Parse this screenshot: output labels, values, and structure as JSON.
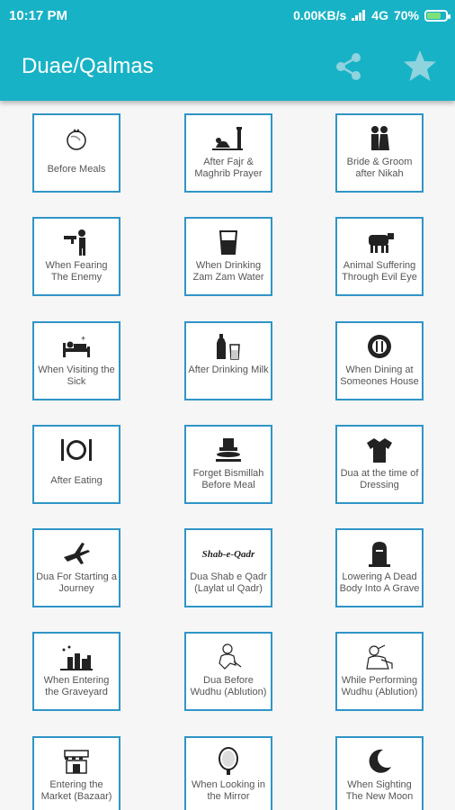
{
  "status_bar": {
    "time": "10:17 PM",
    "network": "0.00KB/s",
    "network_type": "4G",
    "battery": "70%"
  },
  "app_bar": {
    "title": "Duae/Qalmas",
    "share_icon": "share-icon",
    "favorite_icon": "star-icon"
  },
  "items": [
    {
      "label": "Before Meals",
      "icon": "pomegranate-icon"
    },
    {
      "label": "After Fajr & Maghrib Prayer",
      "icon": "prayer-icon"
    },
    {
      "label": "Bride & Groom after Nikah",
      "icon": "couple-icon"
    },
    {
      "label": "When Fearing The Enemy",
      "icon": "gunman-icon"
    },
    {
      "label": "When Drinking Zam Zam Water",
      "icon": "water-glass-icon"
    },
    {
      "label": "Animal Suffering Through Evil Eye",
      "icon": "cow-icon"
    },
    {
      "label": "When Visiting the Sick",
      "icon": "hospital-bed-icon"
    },
    {
      "label": "After Drinking Milk",
      "icon": "milk-icon"
    },
    {
      "label": "When Dining at Someones House",
      "icon": "dining-plate-icon"
    },
    {
      "label": "After Eating",
      "icon": "plate-cutlery-icon"
    },
    {
      "label": "Forget Bismillah Before Meal",
      "icon": "food-stack-icon"
    },
    {
      "label": "Dua at the time of Dressing",
      "icon": "shirt-icon"
    },
    {
      "label": "Dua For Starting a Journey",
      "icon": "airplane-icon"
    },
    {
      "label": "Dua Shab e Qadr (Laylat ul Qadr)",
      "icon": "shab-e-qadr-icon",
      "icon_text": "Shab-e-Qadr"
    },
    {
      "label": "Lowering A Dead Body Into A Grave",
      "icon": "tombstone-icon"
    },
    {
      "label": "When Entering the Graveyard",
      "icon": "graveyard-icon"
    },
    {
      "label": "Dua Before Wudhu (Ablution)",
      "icon": "wudhu-icon"
    },
    {
      "label": "While Performing Wudhu (Ablution)",
      "icon": "washing-icon"
    },
    {
      "label": "Entering the Market (Bazaar)",
      "icon": "market-icon"
    },
    {
      "label": "When Looking in the Mirror",
      "icon": "mirror-icon"
    },
    {
      "label": "When Sighting The New Moon",
      "icon": "crescent-moon-icon"
    }
  ]
}
